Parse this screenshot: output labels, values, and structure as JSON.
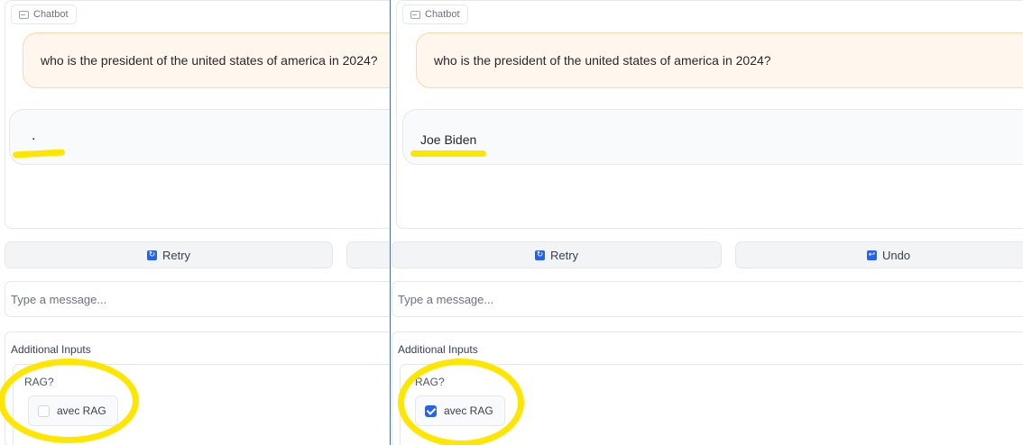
{
  "left": {
    "chatbot_label": "Chatbot",
    "user_message": "who is the president of the united states of america in 2024?",
    "bot_message": ".",
    "retry_label": "Retry",
    "input_placeholder": "Type a message...",
    "additional_inputs_label": "Additional Inputs",
    "rag_label": "RAG?",
    "rag_checkbox_label": "avec RAG",
    "rag_checked": false
  },
  "right": {
    "chatbot_label": "Chatbot",
    "user_message": "who is the president of the united states of america in 2024?",
    "bot_message": "Joe Biden",
    "retry_label": "Retry",
    "undo_label": "Undo",
    "input_placeholder": "Type a message...",
    "additional_inputs_label": "Additional Inputs",
    "rag_label": "RAG?",
    "rag_checkbox_label": "avec RAG",
    "rag_checked": true
  },
  "icons": {
    "chatbot": "chat-icon",
    "retry": "retry-icon",
    "undo": "undo-icon",
    "checkbox_checked": "check-icon"
  },
  "colors": {
    "highlight": "#ffe600",
    "accent": "#2563eb",
    "user_bubble": "#fff7ed",
    "bot_bubble": "#f9fafb"
  }
}
